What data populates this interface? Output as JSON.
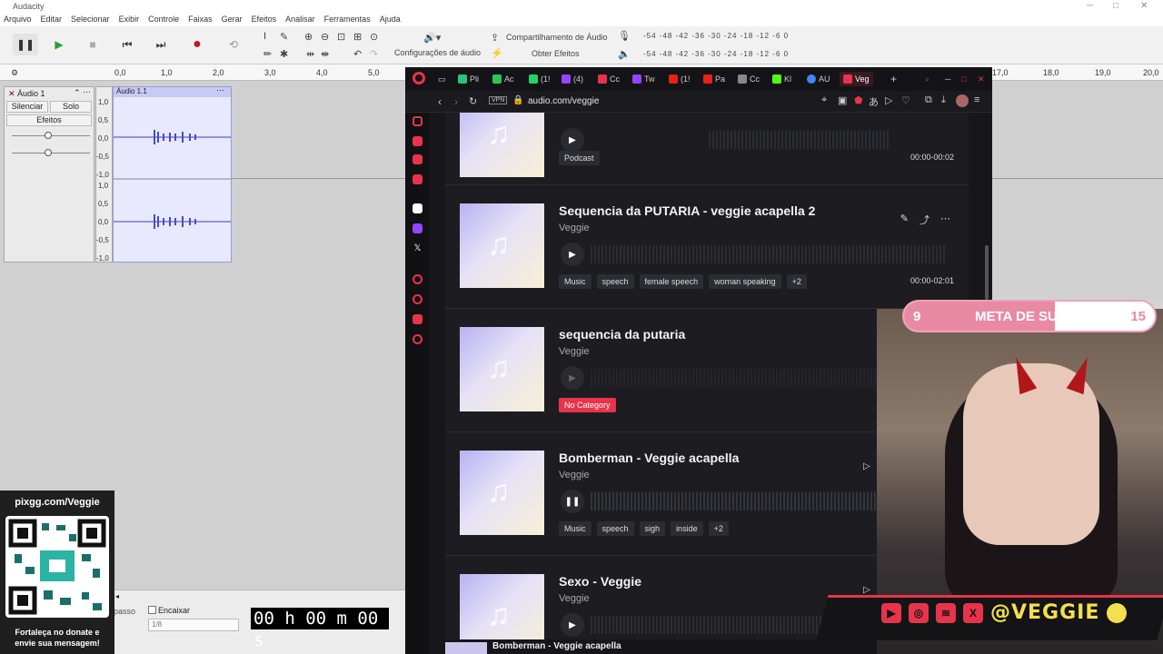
{
  "audacity": {
    "window_title": "Audacity",
    "menu": [
      "Arquivo",
      "Editar",
      "Selecionar",
      "Exibir",
      "Controle",
      "Faixas",
      "Gerar",
      "Efeitos",
      "Analisar",
      "Ferramentas",
      "Ajuda"
    ],
    "share_audio_label": "Compartilhamento de Áudio",
    "get_effects_label": "Obter Efeitos",
    "audio_config_label": "Configurações de áudio",
    "meter_scale": "-54 -48 -42 -36 -30 -24 -18 -12 -6 0",
    "ruler": [
      "0,0",
      "1,0",
      "2,0",
      "3,0",
      "4,0",
      "5,0",
      "17,0",
      "18,0",
      "19,0",
      "20,0"
    ],
    "track_name": "Áudio 1",
    "clip_name": "Áudio 1.1",
    "mute_label": "Silenciar",
    "solo_label": "Solo",
    "effects_label": "Efeitos",
    "y_labels": [
      "1,0",
      "0,5",
      "0,0",
      "-0,5",
      "-1,0"
    ],
    "snap_label": "Encaixar",
    "snap_value": "1/8",
    "step_label": "passo",
    "timecode": "00 h 00 m 00 s"
  },
  "qr_panel": {
    "url": "pixgg.com/Veggie",
    "message": "Fortaleça no donate e envie sua mensagem!"
  },
  "browser": {
    "address": "audio.com/veggie",
    "vpn_label": "VPN",
    "tabs": [
      {
        "label": "Pli",
        "color": "#29c27a"
      },
      {
        "label": "Ac",
        "color": "#2dc653"
      },
      {
        "label": "(1!",
        "color": "#25d366"
      },
      {
        "label": "(4)",
        "color": "#9146ff"
      },
      {
        "label": "Cc",
        "color": "#e8344b"
      },
      {
        "label": "Tw",
        "color": "#9146ff"
      },
      {
        "label": "(1!",
        "color": "#e62117"
      },
      {
        "label": "Pa",
        "color": "#e62117"
      },
      {
        "label": "Cc",
        "color": "#888888"
      },
      {
        "label": "Kl",
        "color": "#53fc18"
      },
      {
        "label": "AU",
        "color": "#4285f4"
      },
      {
        "label": "Veg",
        "color": "#e8344b"
      }
    ]
  },
  "cards": [
    {
      "title": "",
      "artist": "",
      "tags": [
        "Podcast"
      ],
      "duration": "00:00-00:02"
    },
    {
      "title": "Sequencia da PUTARIA - veggie acapella 2",
      "artist": "Veggie",
      "tags": [
        "Music",
        "speech",
        "female speech",
        "woman speaking",
        "+2"
      ],
      "duration": "00:00-02:01"
    },
    {
      "title": "sequencia da putaria",
      "artist": "Veggie",
      "tags": [
        "No Category"
      ],
      "duration": ""
    },
    {
      "title": "Bomberman - Veggie acapella",
      "artist": "Veggie",
      "tags": [
        "Music",
        "speech",
        "sigh",
        "inside",
        "+2"
      ],
      "duration": ""
    },
    {
      "title": "Sexo - Veggie",
      "artist": "Veggie",
      "tags": [],
      "duration": ""
    }
  ],
  "footer_now_playing": "Bomberman - Veggie acapella",
  "stream_overlay": {
    "goal_label": "META DE SUBS",
    "goal_current": "9",
    "goal_target": "15",
    "goal_progress": 0.6,
    "handle": "@VEGGIE"
  },
  "colors": {
    "accent": "#e8344b",
    "goal_pink": "#e88aa3",
    "handle_yellow": "#f4e04d"
  }
}
